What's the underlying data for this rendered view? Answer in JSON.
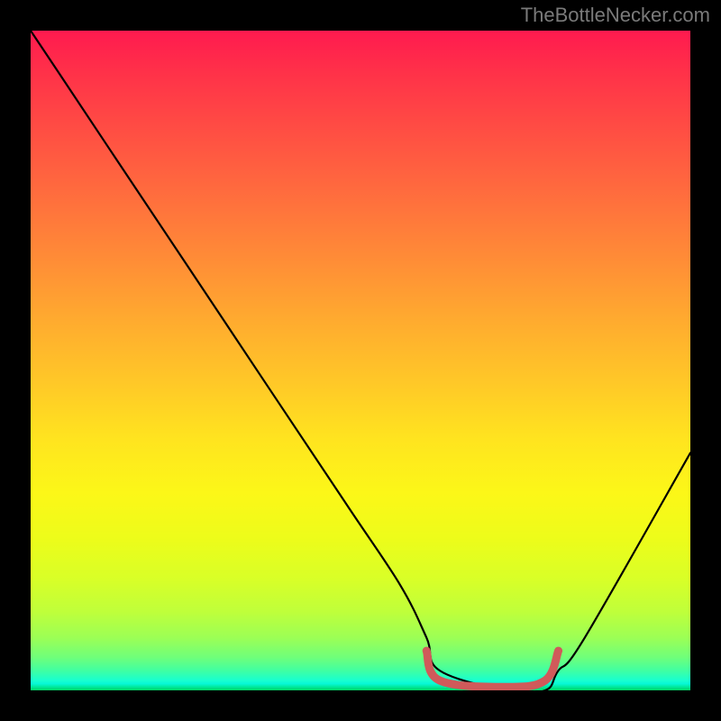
{
  "watermark": "TheBottleNecker.com",
  "chart_data": {
    "type": "line",
    "title": "",
    "xlabel": "",
    "ylabel": "",
    "xlim": [
      0,
      100
    ],
    "ylim": [
      0,
      100
    ],
    "series": [
      {
        "name": "main-curve",
        "color": "#000000",
        "x": [
          0,
          4,
          12,
          24,
          36,
          48,
          56,
          60,
          62,
          72,
          78,
          80,
          84,
          100
        ],
        "y": [
          100,
          94,
          82,
          64,
          46,
          28,
          16,
          8,
          3,
          0,
          0,
          3,
          8,
          36
        ]
      },
      {
        "name": "valley-highlight",
        "color": "#d05a5a",
        "x": [
          60,
          62,
          72,
          78,
          80
        ],
        "y": [
          6,
          1.5,
          0.5,
          1.5,
          6
        ]
      }
    ],
    "gradient_stops": [
      {
        "pos": 0,
        "color": "#ff1a4f"
      },
      {
        "pos": 50,
        "color": "#ffca27"
      },
      {
        "pos": 85,
        "color": "#d9ff27"
      },
      {
        "pos": 100,
        "color": "#00d562"
      }
    ]
  }
}
